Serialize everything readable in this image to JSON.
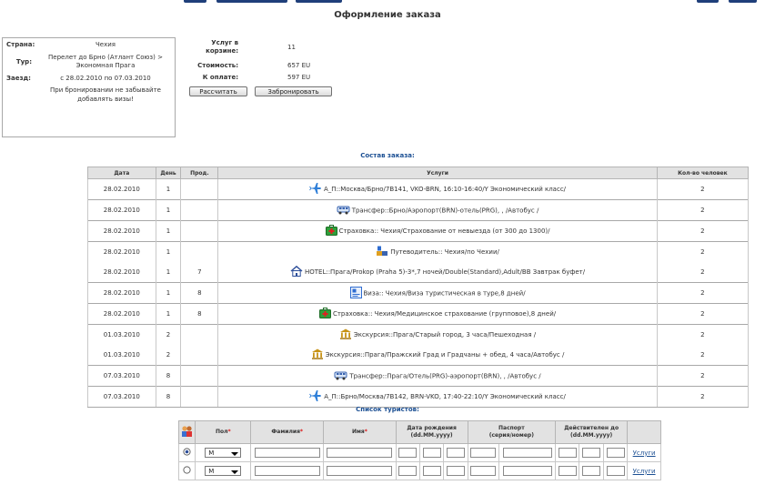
{
  "page_title": "Оформление заказа",
  "info": {
    "country_label": "Страна:",
    "country_value": "Чехия",
    "tour_label": "Тур:",
    "tour_value": "Перелет до Брно (Атлант Союз) > Экономная Прага",
    "stay_label": "Заезд:",
    "stay_value": "с 28.02.2010 по 07.03.2010",
    "note": "При бронировании не забывайте добавлять визы!"
  },
  "summary": {
    "cart_label": "Услуг в корзине:",
    "cart_value": "11",
    "cost_label": "Стоимость:",
    "cost_value": "657 EU",
    "pay_label": "К оплате:",
    "pay_value": "597 EU",
    "calc_button": "Рассчитать",
    "book_button": "Забронировать"
  },
  "order": {
    "title": "Состав заказа:",
    "headers": [
      "Дата",
      "День",
      "Прод.",
      "Услуги",
      "Кол-во человек"
    ],
    "rows": [
      {
        "date": "28.02.2010",
        "day": "1",
        "prod": "",
        "icon": "plane-icon",
        "service": "А_П::Москва/Брно/7B141, VKO-BRN, 16:10-16:40/Y Экономический класс/",
        "people": "2"
      },
      {
        "date": "28.02.2010",
        "day": "1",
        "prod": "",
        "icon": "bus-icon",
        "service": "Трансфер::Брно/Аэропорт(BRN)-отель(PRG), , /Автобус /",
        "people": "2"
      },
      {
        "date": "28.02.2010",
        "day": "1",
        "prod": "",
        "icon": "medkit-icon",
        "service": "Страховка:: Чехия/Страхование от невыезда (от 300 до 1300)/",
        "people": "2"
      },
      {
        "date": "28.02.2010",
        "day": "1",
        "prod": "",
        "icon": "guide-icon",
        "service": "Путеводитель:: Чехия/по Чехии/",
        "people": "2"
      },
      {
        "date": "28.02.2010",
        "day": "1",
        "prod": "7",
        "icon": "house-icon",
        "service": "HOTEL::Прага/Prokop (Praha 5)-3*,7 ночей/Double(Standard),Adult/BB Завтрак буфет/",
        "people": "2"
      },
      {
        "date": "28.02.2010",
        "day": "1",
        "prod": "8",
        "icon": "visa-icon",
        "service": "Виза:: Чехия/Виза туристическая в туре,8 дней/",
        "people": "2"
      },
      {
        "date": "28.02.2010",
        "day": "1",
        "prod": "8",
        "icon": "medkit-icon",
        "service": "Страховка:: Чехия/Медицинское страхование (групповое),8 дней/",
        "people": "2"
      },
      {
        "date": "01.03.2010",
        "day": "2",
        "prod": "",
        "icon": "museum-icon",
        "service": "Экскурсия::Прага/Старый город, 3 часа/Пешеходная /",
        "people": "2"
      },
      {
        "date": "01.03.2010",
        "day": "2",
        "prod": "",
        "icon": "museum-icon",
        "service": "Экскурсия::Прага/Пражский Град и Градчаны + обед, 4 часа/Автобус /",
        "people": "2"
      },
      {
        "date": "07.03.2010",
        "day": "8",
        "prod": "",
        "icon": "bus-icon",
        "service": "Трансфер::Прага/Отель(PRG)-аэропорт(BRN), , /Автобус /",
        "people": "2"
      },
      {
        "date": "07.03.2010",
        "day": "8",
        "prod": "",
        "icon": "plane-icon",
        "service": "А_П::Брно/Москва/7B142, BRN-VKO, 17:40-22:10/Y Экономический класс/",
        "people": "2"
      }
    ]
  },
  "tourists": {
    "title": "Список туристов:",
    "headers": {
      "sex": "Пол",
      "surname": "Фамилия",
      "name": "Имя",
      "birth": "Дата рождения",
      "birth_format": "(dd.MM.yyyy)",
      "passport": "Паспорт",
      "passport_format": "(серия/номер)",
      "valid": "Действителен до",
      "valid_format": "(dd.MM.yyyy)",
      "required_mark": "*"
    },
    "rows": [
      {
        "sex": "M",
        "services_link": "Услуги"
      },
      {
        "sex": "M",
        "services_link": "Услуги"
      }
    ]
  }
}
